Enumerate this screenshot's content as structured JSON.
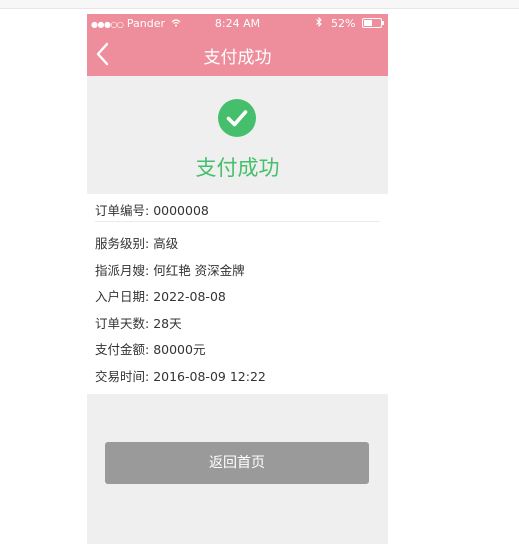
{
  "status_bar": {
    "signal": "●●●○○",
    "carrier": "Pander",
    "time": "8:24 AM",
    "battery_text": "52%",
    "battery_level": 0.52
  },
  "nav": {
    "title": "支付成功"
  },
  "success": {
    "message": "支付成功"
  },
  "order": {
    "number_label": "订单编号:",
    "number_value": "0000008",
    "details": [
      {
        "label": "服务级别:",
        "value": "高级"
      },
      {
        "label": "指派月嫂:",
        "value": "何红艳  资深金牌"
      },
      {
        "label": "入户日期:",
        "value": "2022-08-08"
      },
      {
        "label": "订单天数:",
        "value": "28天"
      },
      {
        "label": "支付金额:",
        "value": "80000元"
      },
      {
        "label": "交易时间:",
        "value": "2016-08-09  12:22"
      }
    ]
  },
  "actions": {
    "home_label": "返回首页"
  },
  "colors": {
    "brand": "#ee8e9c",
    "success": "#45bf6c",
    "button": "#9a9a9a"
  }
}
